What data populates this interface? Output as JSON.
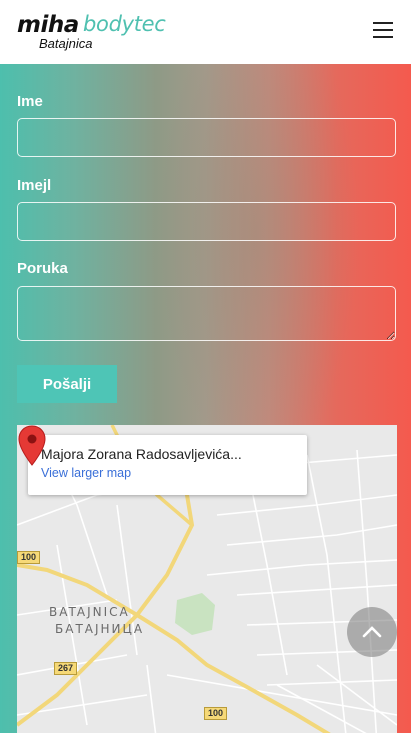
{
  "header": {
    "logo": {
      "word1": "miha",
      "word2": "bodytec",
      "sub": "Batajnica"
    },
    "menu_icon": "hamburger-menu-icon"
  },
  "form": {
    "name_label": "Ime",
    "email_label": "Imejl",
    "message_label": "Poruka",
    "name_value": "",
    "email_value": "",
    "message_value": "",
    "submit_label": "Pošalji"
  },
  "map": {
    "place_name": "Majora Zorana Radosavljevića...",
    "link_label": "View larger map",
    "area_label_latin": "BATAJNICA",
    "area_label_cyrillic": "БАТАЈНИЦА",
    "road_shields": [
      "100",
      "267",
      "100"
    ],
    "pin_icon": "map-pin-icon"
  },
  "scroll_top": {
    "icon": "chevron-up-icon"
  },
  "colors": {
    "brand_teal": "#4ec5b6",
    "brand_red": "#f45a4e",
    "link_blue": "#3a6fd8",
    "pin_red": "#e53935"
  }
}
